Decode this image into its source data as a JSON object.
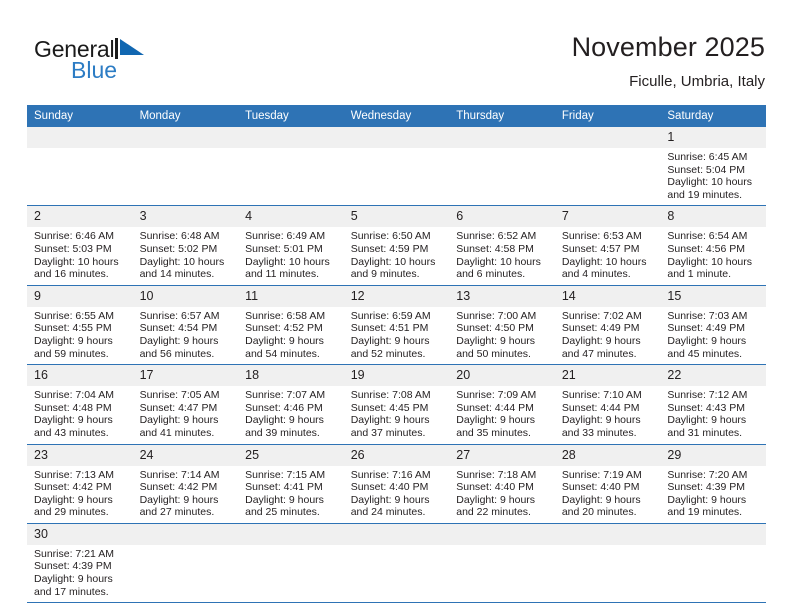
{
  "brand": {
    "name_top": "General",
    "name_bottom": "Blue",
    "flag_icon": "blue-triangle-flag-icon",
    "accent_color": "#2c7cc4"
  },
  "header": {
    "title": "November 2025",
    "subtitle": "Ficulle, Umbria, Italy"
  },
  "colors": {
    "header_blue": "#2e73b5",
    "daynum_band": "#f0f0f0",
    "text": "#231f20"
  },
  "weekdays": [
    "Sunday",
    "Monday",
    "Tuesday",
    "Wednesday",
    "Thursday",
    "Friday",
    "Saturday"
  ],
  "labels": {
    "sunrise_prefix": "Sunrise:",
    "sunset_prefix": "Sunset:",
    "daylight_prefix": "Daylight:"
  },
  "weeks": [
    [
      {
        "day": "",
        "sunrise": "",
        "sunset": "",
        "daylight_line1": "",
        "daylight_line2": ""
      },
      {
        "day": "",
        "sunrise": "",
        "sunset": "",
        "daylight_line1": "",
        "daylight_line2": ""
      },
      {
        "day": "",
        "sunrise": "",
        "sunset": "",
        "daylight_line1": "",
        "daylight_line2": ""
      },
      {
        "day": "",
        "sunrise": "",
        "sunset": "",
        "daylight_line1": "",
        "daylight_line2": ""
      },
      {
        "day": "",
        "sunrise": "",
        "sunset": "",
        "daylight_line1": "",
        "daylight_line2": ""
      },
      {
        "day": "",
        "sunrise": "",
        "sunset": "",
        "daylight_line1": "",
        "daylight_line2": ""
      },
      {
        "day": "1",
        "sunrise": "Sunrise: 6:45 AM",
        "sunset": "Sunset: 5:04 PM",
        "daylight_line1": "Daylight: 10 hours",
        "daylight_line2": "and 19 minutes."
      }
    ],
    [
      {
        "day": "2",
        "sunrise": "Sunrise: 6:46 AM",
        "sunset": "Sunset: 5:03 PM",
        "daylight_line1": "Daylight: 10 hours",
        "daylight_line2": "and 16 minutes."
      },
      {
        "day": "3",
        "sunrise": "Sunrise: 6:48 AM",
        "sunset": "Sunset: 5:02 PM",
        "daylight_line1": "Daylight: 10 hours",
        "daylight_line2": "and 14 minutes."
      },
      {
        "day": "4",
        "sunrise": "Sunrise: 6:49 AM",
        "sunset": "Sunset: 5:01 PM",
        "daylight_line1": "Daylight: 10 hours",
        "daylight_line2": "and 11 minutes."
      },
      {
        "day": "5",
        "sunrise": "Sunrise: 6:50 AM",
        "sunset": "Sunset: 4:59 PM",
        "daylight_line1": "Daylight: 10 hours",
        "daylight_line2": "and 9 minutes."
      },
      {
        "day": "6",
        "sunrise": "Sunrise: 6:52 AM",
        "sunset": "Sunset: 4:58 PM",
        "daylight_line1": "Daylight: 10 hours",
        "daylight_line2": "and 6 minutes."
      },
      {
        "day": "7",
        "sunrise": "Sunrise: 6:53 AM",
        "sunset": "Sunset: 4:57 PM",
        "daylight_line1": "Daylight: 10 hours",
        "daylight_line2": "and 4 minutes."
      },
      {
        "day": "8",
        "sunrise": "Sunrise: 6:54 AM",
        "sunset": "Sunset: 4:56 PM",
        "daylight_line1": "Daylight: 10 hours",
        "daylight_line2": "and 1 minute."
      }
    ],
    [
      {
        "day": "9",
        "sunrise": "Sunrise: 6:55 AM",
        "sunset": "Sunset: 4:55 PM",
        "daylight_line1": "Daylight: 9 hours",
        "daylight_line2": "and 59 minutes."
      },
      {
        "day": "10",
        "sunrise": "Sunrise: 6:57 AM",
        "sunset": "Sunset: 4:54 PM",
        "daylight_line1": "Daylight: 9 hours",
        "daylight_line2": "and 56 minutes."
      },
      {
        "day": "11",
        "sunrise": "Sunrise: 6:58 AM",
        "sunset": "Sunset: 4:52 PM",
        "daylight_line1": "Daylight: 9 hours",
        "daylight_line2": "and 54 minutes."
      },
      {
        "day": "12",
        "sunrise": "Sunrise: 6:59 AM",
        "sunset": "Sunset: 4:51 PM",
        "daylight_line1": "Daylight: 9 hours",
        "daylight_line2": "and 52 minutes."
      },
      {
        "day": "13",
        "sunrise": "Sunrise: 7:00 AM",
        "sunset": "Sunset: 4:50 PM",
        "daylight_line1": "Daylight: 9 hours",
        "daylight_line2": "and 50 minutes."
      },
      {
        "day": "14",
        "sunrise": "Sunrise: 7:02 AM",
        "sunset": "Sunset: 4:49 PM",
        "daylight_line1": "Daylight: 9 hours",
        "daylight_line2": "and 47 minutes."
      },
      {
        "day": "15",
        "sunrise": "Sunrise: 7:03 AM",
        "sunset": "Sunset: 4:49 PM",
        "daylight_line1": "Daylight: 9 hours",
        "daylight_line2": "and 45 minutes."
      }
    ],
    [
      {
        "day": "16",
        "sunrise": "Sunrise: 7:04 AM",
        "sunset": "Sunset: 4:48 PM",
        "daylight_line1": "Daylight: 9 hours",
        "daylight_line2": "and 43 minutes."
      },
      {
        "day": "17",
        "sunrise": "Sunrise: 7:05 AM",
        "sunset": "Sunset: 4:47 PM",
        "daylight_line1": "Daylight: 9 hours",
        "daylight_line2": "and 41 minutes."
      },
      {
        "day": "18",
        "sunrise": "Sunrise: 7:07 AM",
        "sunset": "Sunset: 4:46 PM",
        "daylight_line1": "Daylight: 9 hours",
        "daylight_line2": "and 39 minutes."
      },
      {
        "day": "19",
        "sunrise": "Sunrise: 7:08 AM",
        "sunset": "Sunset: 4:45 PM",
        "daylight_line1": "Daylight: 9 hours",
        "daylight_line2": "and 37 minutes."
      },
      {
        "day": "20",
        "sunrise": "Sunrise: 7:09 AM",
        "sunset": "Sunset: 4:44 PM",
        "daylight_line1": "Daylight: 9 hours",
        "daylight_line2": "and 35 minutes."
      },
      {
        "day": "21",
        "sunrise": "Sunrise: 7:10 AM",
        "sunset": "Sunset: 4:44 PM",
        "daylight_line1": "Daylight: 9 hours",
        "daylight_line2": "and 33 minutes."
      },
      {
        "day": "22",
        "sunrise": "Sunrise: 7:12 AM",
        "sunset": "Sunset: 4:43 PM",
        "daylight_line1": "Daylight: 9 hours",
        "daylight_line2": "and 31 minutes."
      }
    ],
    [
      {
        "day": "23",
        "sunrise": "Sunrise: 7:13 AM",
        "sunset": "Sunset: 4:42 PM",
        "daylight_line1": "Daylight: 9 hours",
        "daylight_line2": "and 29 minutes."
      },
      {
        "day": "24",
        "sunrise": "Sunrise: 7:14 AM",
        "sunset": "Sunset: 4:42 PM",
        "daylight_line1": "Daylight: 9 hours",
        "daylight_line2": "and 27 minutes."
      },
      {
        "day": "25",
        "sunrise": "Sunrise: 7:15 AM",
        "sunset": "Sunset: 4:41 PM",
        "daylight_line1": "Daylight: 9 hours",
        "daylight_line2": "and 25 minutes."
      },
      {
        "day": "26",
        "sunrise": "Sunrise: 7:16 AM",
        "sunset": "Sunset: 4:40 PM",
        "daylight_line1": "Daylight: 9 hours",
        "daylight_line2": "and 24 minutes."
      },
      {
        "day": "27",
        "sunrise": "Sunrise: 7:18 AM",
        "sunset": "Sunset: 4:40 PM",
        "daylight_line1": "Daylight: 9 hours",
        "daylight_line2": "and 22 minutes."
      },
      {
        "day": "28",
        "sunrise": "Sunrise: 7:19 AM",
        "sunset": "Sunset: 4:40 PM",
        "daylight_line1": "Daylight: 9 hours",
        "daylight_line2": "and 20 minutes."
      },
      {
        "day": "29",
        "sunrise": "Sunrise: 7:20 AM",
        "sunset": "Sunset: 4:39 PM",
        "daylight_line1": "Daylight: 9 hours",
        "daylight_line2": "and 19 minutes."
      }
    ],
    [
      {
        "day": "30",
        "sunrise": "Sunrise: 7:21 AM",
        "sunset": "Sunset: 4:39 PM",
        "daylight_line1": "Daylight: 9 hours",
        "daylight_line2": "and 17 minutes."
      },
      {
        "day": "",
        "sunrise": "",
        "sunset": "",
        "daylight_line1": "",
        "daylight_line2": ""
      },
      {
        "day": "",
        "sunrise": "",
        "sunset": "",
        "daylight_line1": "",
        "daylight_line2": ""
      },
      {
        "day": "",
        "sunrise": "",
        "sunset": "",
        "daylight_line1": "",
        "daylight_line2": ""
      },
      {
        "day": "",
        "sunrise": "",
        "sunset": "",
        "daylight_line1": "",
        "daylight_line2": ""
      },
      {
        "day": "",
        "sunrise": "",
        "sunset": "",
        "daylight_line1": "",
        "daylight_line2": ""
      },
      {
        "day": "",
        "sunrise": "",
        "sunset": "",
        "daylight_line1": "",
        "daylight_line2": ""
      }
    ]
  ]
}
